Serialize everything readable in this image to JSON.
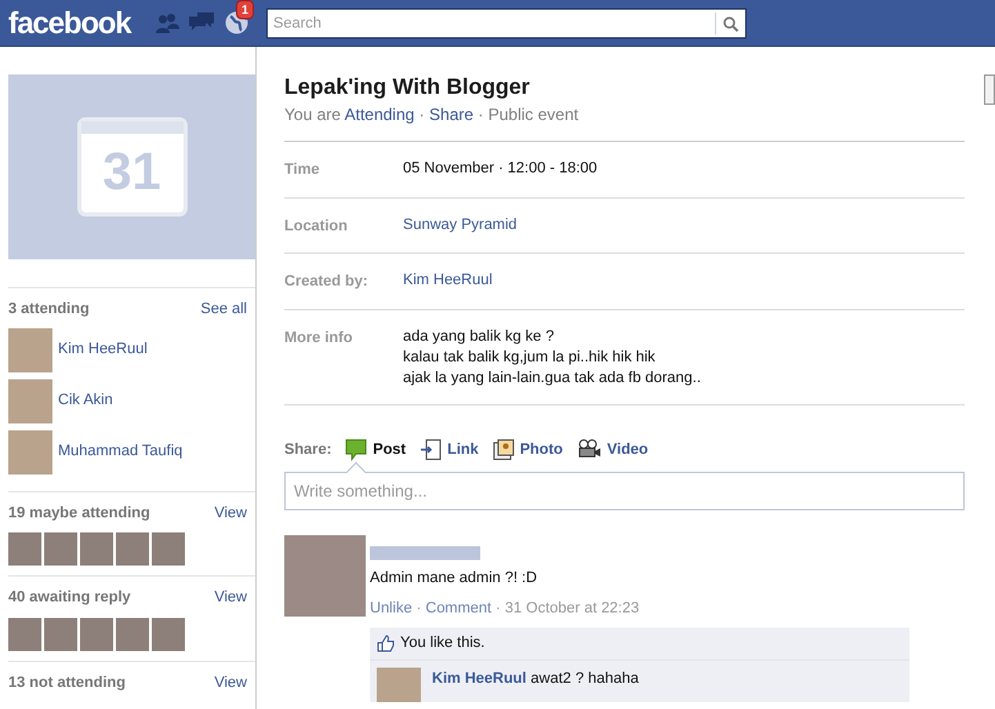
{
  "header": {
    "logo": "facebook",
    "notifications_badge": "1",
    "search": {
      "placeholder": "Search"
    }
  },
  "calendar": {
    "day": "31"
  },
  "sidebar": {
    "sections": [
      {
        "title": "3 attending",
        "action": "See all",
        "kind": "list",
        "people": [
          {
            "name": "Kim HeeRuul"
          },
          {
            "name": "Cik Akin"
          },
          {
            "name": "Muhammad Taufiq"
          }
        ]
      },
      {
        "title": "19 maybe attending",
        "action": "View",
        "kind": "thumbs"
      },
      {
        "title": "40 awaiting reply",
        "action": "View",
        "kind": "thumbs"
      },
      {
        "title": "13 not attending",
        "action": "View",
        "kind": "none"
      }
    ]
  },
  "event": {
    "title": "Lepak'ing With Blogger",
    "status_prefix": "You are",
    "status": "Attending",
    "share": "Share",
    "privacy": "Public event",
    "separator": "·",
    "details": [
      {
        "label": "Time",
        "kind": "text",
        "lines": [
          "05 November · 12:00 - 18:00"
        ]
      },
      {
        "label": "Location",
        "kind": "link",
        "lines": [
          "Sunway Pyramid"
        ]
      },
      {
        "label": "Created by:",
        "kind": "link",
        "lines": [
          "Kim HeeRuul"
        ]
      },
      {
        "label": "More info",
        "kind": "text",
        "lines": [
          "ada yang balik kg ke ?",
          "kalau tak balik kg,jum la pi..hik hik hik",
          "ajak la yang lain-lain.gua tak ada fb dorang.."
        ]
      }
    ]
  },
  "composer": {
    "label": "Share:",
    "options": [
      {
        "label": "Post",
        "kind": "post",
        "selected": true
      },
      {
        "label": "Link",
        "kind": "link",
        "selected": false
      },
      {
        "label": "Photo",
        "kind": "photo",
        "selected": false
      },
      {
        "label": "Video",
        "kind": "video",
        "selected": false
      }
    ],
    "placeholder": "Write something..."
  },
  "post": {
    "separator": "·",
    "message": "Admin mane admin ?! :D",
    "actions": [
      "Unlike",
      "Comment"
    ],
    "time": "31 October at 22:23",
    "likes": "You like this.",
    "comment": {
      "author": "Kim HeeRuul",
      "text": "awat2 ? hahaha"
    }
  }
}
